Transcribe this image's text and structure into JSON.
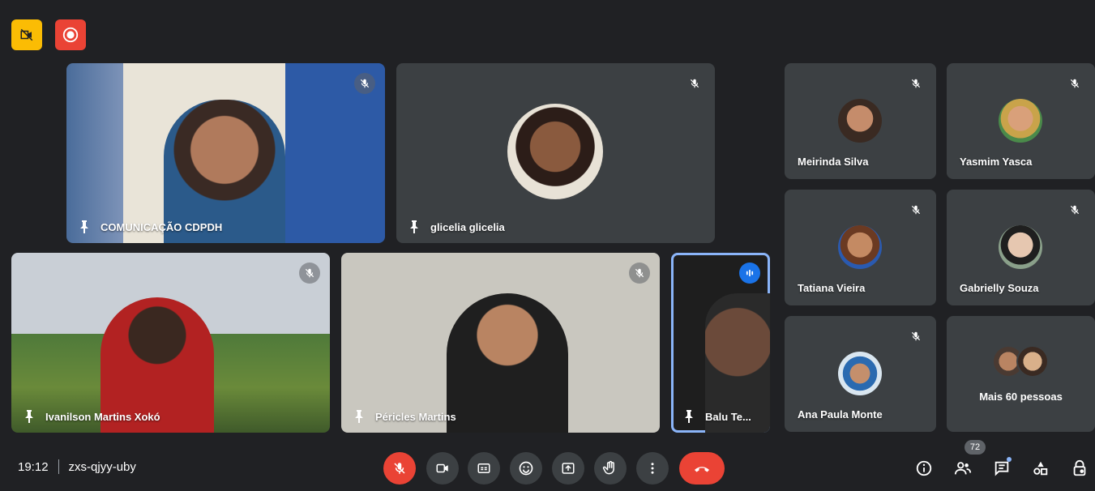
{
  "meeting": {
    "time": "19:12",
    "code": "zxs-qjyy-uby"
  },
  "participants_count": "72",
  "tiles": [
    {
      "name": "COMUNICAÇÃO CDPDH"
    },
    {
      "name": "glicelia glicelia"
    },
    {
      "name": "Ivanilson Martins Xokó"
    },
    {
      "name": "Péricles Martins"
    },
    {
      "name": "Balu Te..."
    }
  ],
  "side_tiles": [
    {
      "name": "Meirinda Silva"
    },
    {
      "name": "Yasmim Yasca"
    },
    {
      "name": "Tatiana Vieira"
    },
    {
      "name": "Gabrielly Souza"
    },
    {
      "name": "Ana Paula Monte"
    },
    {
      "name": "Mais 60 pessoas"
    }
  ],
  "icons": {
    "top": [
      "camera-off-icon",
      "record-icon"
    ],
    "controls": [
      "mic-off-icon",
      "camera-icon",
      "captions-icon",
      "emoji-icon",
      "present-icon",
      "raise-hand-icon",
      "more-icon",
      "end-call-icon"
    ],
    "right": [
      "info-icon",
      "people-icon",
      "chat-icon",
      "activities-icon",
      "host-controls-icon"
    ]
  },
  "colors": {
    "background": "#202124",
    "tile": "#3c4043",
    "danger": "#ea4335",
    "accent": "#1a73e8",
    "recording_badge": "#fbbc04"
  }
}
